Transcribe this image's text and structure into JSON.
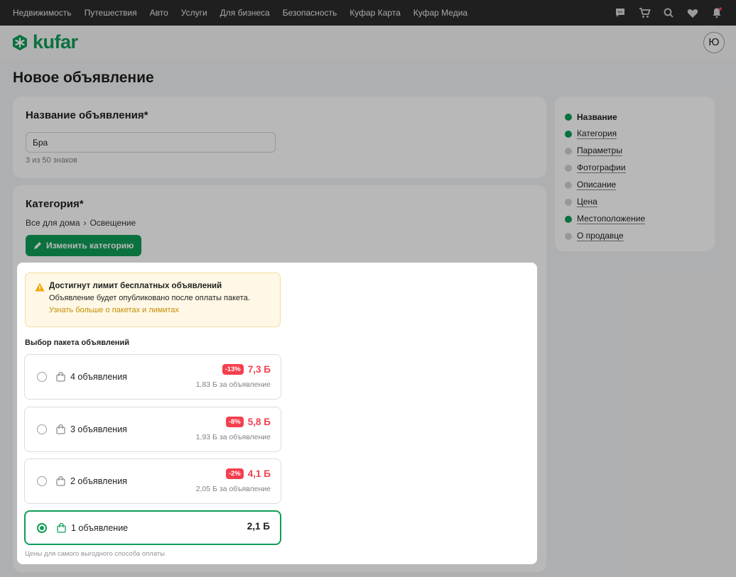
{
  "topnav": {
    "links": [
      "Недвижимость",
      "Путешествия",
      "Авто",
      "Услуги",
      "Для бизнеса",
      "Безопасность",
      "Куфар Карта",
      "Куфар Медиа"
    ],
    "icons": [
      "chat-icon",
      "cart-icon",
      "search-heart-icon",
      "heart-icon",
      "bell-icon"
    ]
  },
  "header": {
    "logo_text": "kufar",
    "avatar_initial": "Ю"
  },
  "page_title": "Новое объявление",
  "title_card": {
    "heading": "Название объявления*",
    "value": "Бра",
    "hint": "3 из 50 знаков"
  },
  "category_card": {
    "heading": "Категория*",
    "breadcrumb": [
      "Все для дома",
      "Освещение"
    ],
    "separator": "›",
    "change_button": "Изменить категорию"
  },
  "steps": [
    {
      "label": "Название",
      "done": true,
      "active": true
    },
    {
      "label": "Категория",
      "done": true,
      "active": false
    },
    {
      "label": "Параметры",
      "done": false,
      "active": false
    },
    {
      "label": "Фотографии",
      "done": false,
      "active": false
    },
    {
      "label": "Описание",
      "done": false,
      "active": false
    },
    {
      "label": "Цена",
      "done": false,
      "active": false
    },
    {
      "label": "Местоположение",
      "done": true,
      "active": false
    },
    {
      "label": "О продавце",
      "done": false,
      "active": false
    }
  ],
  "modal": {
    "warning": {
      "title": "Достигнут лимит бесплатных объявлений",
      "text": "Объявление будет опубликовано после оплаты пакета.",
      "link": "Узнать больше о пакетах и лимитах"
    },
    "section_title": "Выбор пакета объявлений",
    "packages": [
      {
        "name": "4 объявления",
        "discount": "-13%",
        "price": "7,3 Б",
        "per": "1,83 Б за объявление",
        "selected": false
      },
      {
        "name": "3 объявления",
        "discount": "-8%",
        "price": "5,8 Б",
        "per": "1,93 Б за объявление",
        "selected": false
      },
      {
        "name": "2 объявления",
        "discount": "-2%",
        "price": "4,1 Б",
        "per": "2,05 Б за объявление",
        "selected": false
      },
      {
        "name": "1 объявление",
        "discount": "",
        "price": "2,1 Б",
        "per": "",
        "selected": true
      }
    ],
    "footnote": "Цены для самого выгодного способа оплаты"
  },
  "colors": {
    "brand": "#0f9d58",
    "discount": "#f43f4e",
    "warning_bg": "#fff8e6"
  }
}
